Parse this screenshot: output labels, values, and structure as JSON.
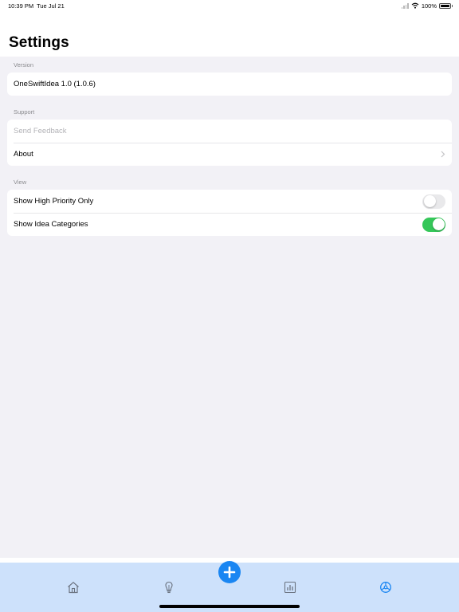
{
  "status_bar": {
    "time": "10:39 PM",
    "date": "Tue Jul 21",
    "battery": "100%"
  },
  "header": {
    "title": "Settings"
  },
  "sections": {
    "version": {
      "label": "Version",
      "rows": [
        {
          "label": "OneSwiftIdea 1.0 (1.0.6)"
        }
      ]
    },
    "support": {
      "label": "Support",
      "rows": [
        {
          "label": "Send Feedback",
          "disabled": true
        },
        {
          "label": "About",
          "chevron": true
        }
      ]
    },
    "view": {
      "label": "View",
      "rows": [
        {
          "label": "Show High Priority Only",
          "toggle": false
        },
        {
          "label": "Show Idea Categories",
          "toggle": true
        }
      ]
    }
  },
  "tab_bar": {
    "items": [
      {
        "icon": "home-icon"
      },
      {
        "icon": "lightbulb-icon"
      },
      {
        "icon": "add-icon"
      },
      {
        "icon": "chart-icon"
      },
      {
        "icon": "settings-icon",
        "selected": true
      }
    ]
  },
  "colors": {
    "accent": "#1a86f2",
    "toggle_on": "#35c759",
    "tab_bar_bg": "#cde1fb",
    "page_bg": "#f2f1f6"
  }
}
